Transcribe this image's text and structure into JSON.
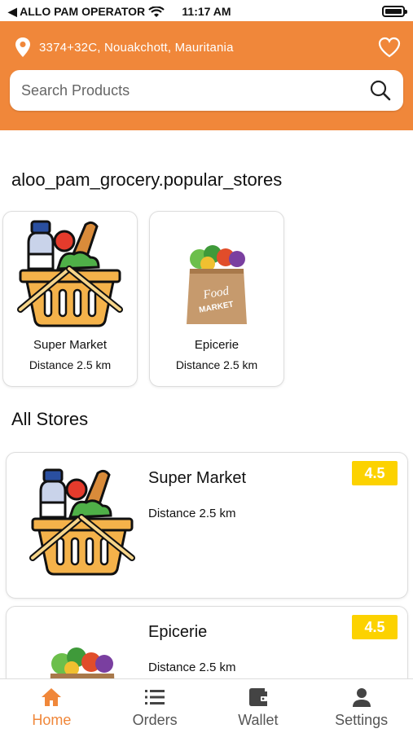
{
  "status_bar": {
    "carrier": "◀ ALLO PAM OPERATOR",
    "time": "11:17 AM"
  },
  "header": {
    "location": "3374+32C, Nouakchott, Mauritania",
    "search_placeholder": "Search Products",
    "accent_color": "#f0873a"
  },
  "popular": {
    "title": "aloo_pam_grocery.popular_stores",
    "stores": [
      {
        "name": "Super Market",
        "distance": "Distance 2.5 km",
        "icon": "grocery-basket-icon"
      },
      {
        "name": "Epicerie",
        "distance": "Distance 2.5 km",
        "icon": "food-market-bag-icon"
      }
    ]
  },
  "all_stores": {
    "title": "All Stores",
    "stores": [
      {
        "name": "Super Market",
        "distance": "Distance 2.5 km",
        "rating": "4.5",
        "icon": "grocery-basket-icon"
      },
      {
        "name": "Epicerie",
        "distance": "Distance 2.5 km",
        "rating": "4.5",
        "icon": "food-market-bag-icon"
      }
    ]
  },
  "bottom_nav": {
    "items": [
      {
        "label": "Home",
        "icon": "home-icon",
        "active": true
      },
      {
        "label": "Orders",
        "icon": "list-icon"
      },
      {
        "label": "Wallet",
        "icon": "wallet-icon"
      },
      {
        "label": "Settings",
        "icon": "user-icon"
      }
    ]
  }
}
